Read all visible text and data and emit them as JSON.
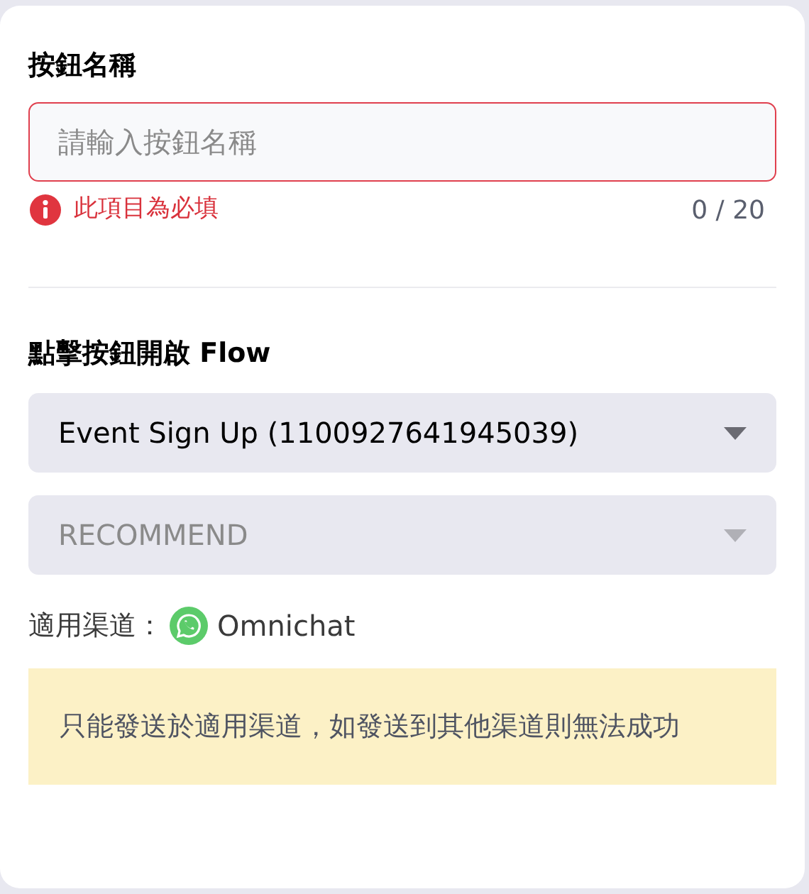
{
  "name_field": {
    "label": "按鈕名稱",
    "placeholder": "請輸入按鈕名稱",
    "error": true,
    "error_message": "此項目為必填",
    "counter": "0 / 20"
  },
  "flow": {
    "label": "點擊按鈕開啟 Flow",
    "dropdowns": [
      {
        "value": "Event Sign Up (1100927641945039)",
        "disabled": false
      },
      {
        "value": "RECOMMEND",
        "disabled": true
      }
    ]
  },
  "channel": {
    "label": "適用渠道：",
    "name": "Omnichat"
  },
  "note": "只能發送於適用渠道，如發送到其他渠道則無法成功"
}
